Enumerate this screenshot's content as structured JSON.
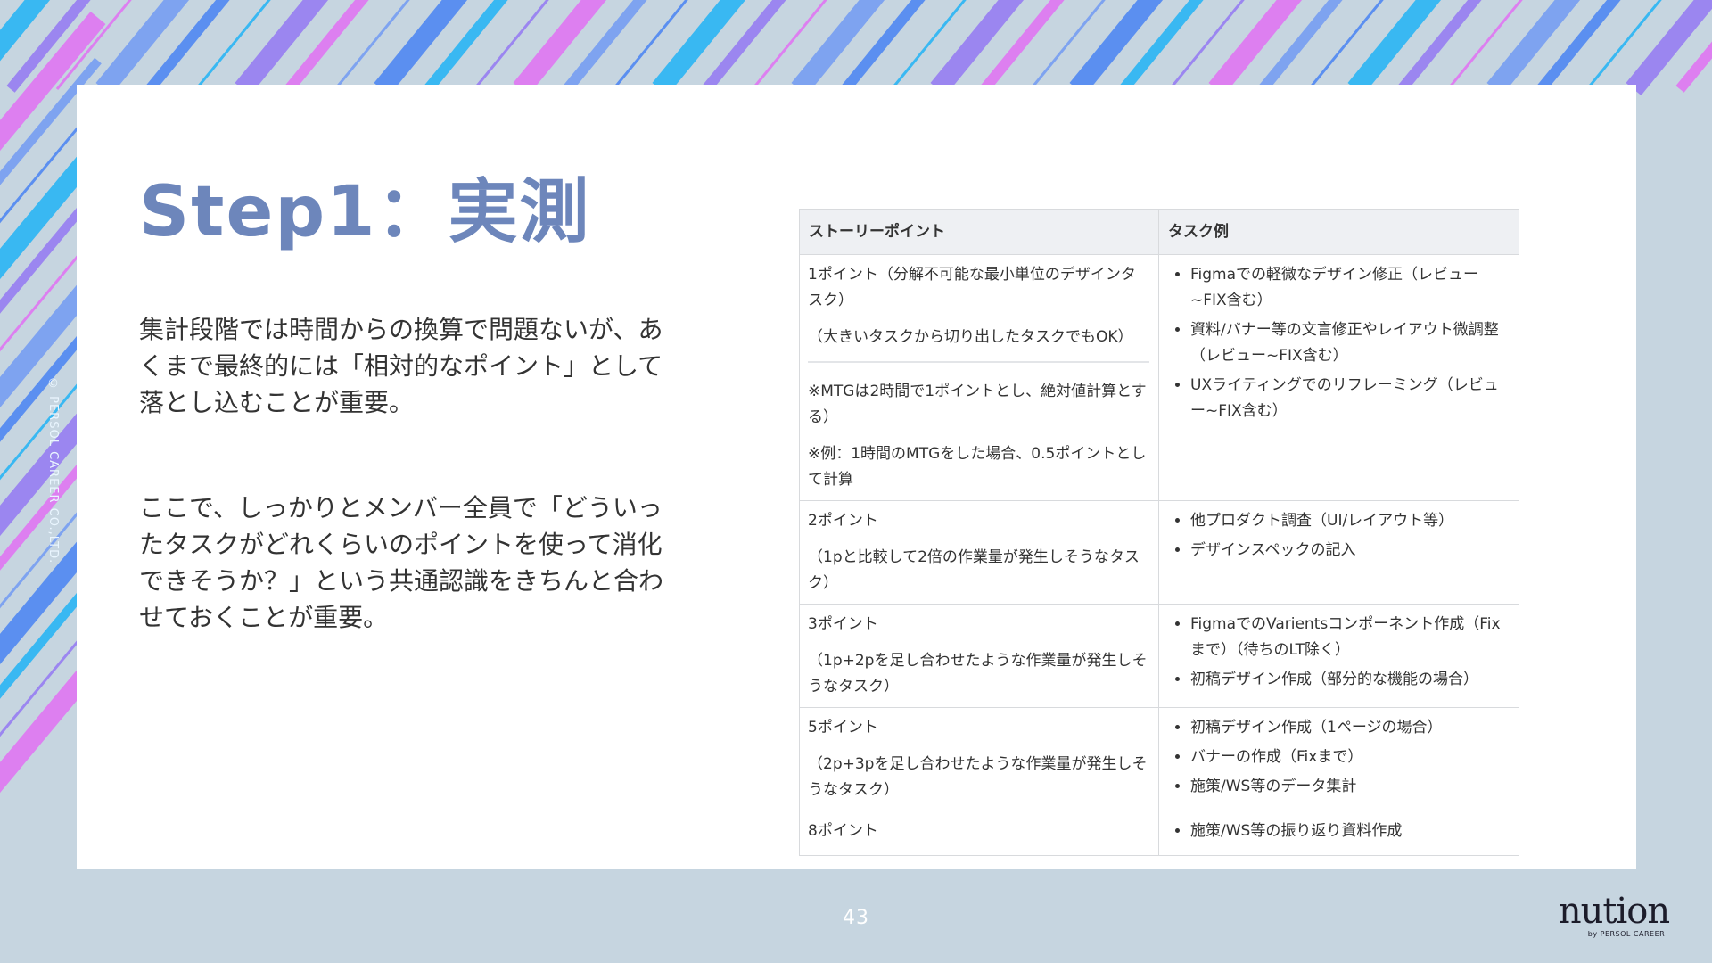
{
  "slide": {
    "title": "Step1：実測",
    "paragraphs": [
      "集計段階では時間からの換算で問題ないが、あくまで最終的には「相対的なポイント」として落とし込むことが重要。",
      "ここで、しっかりとメンバー全員で「どういったタスクがどれくらいのポイントを使って消化できそうか？」という共通認識をきちんと合わせておくことが重要。"
    ]
  },
  "table": {
    "headers": [
      "ストーリーポイント",
      "タスク例"
    ],
    "rows": [
      {
        "point": "1ポイント（分解不可能な最小単位のデザインタスク）",
        "description": "（大きいタスクから切り出したタスクでもOK）",
        "notes": [
          "※MTGは2時間で1ポイントとし、絶対値計算とする）",
          "※例：1時間のMTGをした場合、0.5ポイントとして計算"
        ],
        "tasks": [
          "Figmaでの軽微なデザイン修正（レビュー~FIX含む）",
          "資料/バナー等の文言修正やレイアウト微調整（レビュー~FIX含む）",
          "UXライティングでのリフレーミング（レビュー~FIX含む）"
        ]
      },
      {
        "point": "2ポイント",
        "description": "（1pと比較して2倍の作業量が発生しそうなタスク）",
        "tasks": [
          "他プロダクト調査（UI/レイアウト等）",
          "デザインスペックの記入"
        ]
      },
      {
        "point": "3ポイント",
        "description": "（1p+2pを足し合わせたような作業量が発生しそうなタスク）",
        "tasks": [
          "FigmaでのVarientsコンポーネント作成（Fixまで）（待ちのLT除く）",
          "初稿デザイン作成（部分的な機能の場合）"
        ]
      },
      {
        "point": "5ポイント",
        "description": "（2p+3pを足し合わせたような作業量が発生しそうなタスク）",
        "tasks": [
          "初稿デザイン作成（1ページの場合）",
          "バナーの作成（Fixまで）",
          "施策/WS等のデータ集計"
        ]
      },
      {
        "point": "8ポイント",
        "tasks": [
          "施策/WS等の振り返り資料作成"
        ]
      }
    ]
  },
  "footer": {
    "page_number": "43",
    "copyright": "© PERSOL CAREER CO.,LTD.",
    "logo_text": "nution",
    "logo_sub": "by PERSOL CAREER"
  },
  "colors": {
    "background": "#c6d5e0",
    "title": "#6d86bb",
    "stripe_blue": "#39b8f2",
    "stripe_violet": "#9b86f0",
    "stripe_pink": "#dd7ff0"
  }
}
